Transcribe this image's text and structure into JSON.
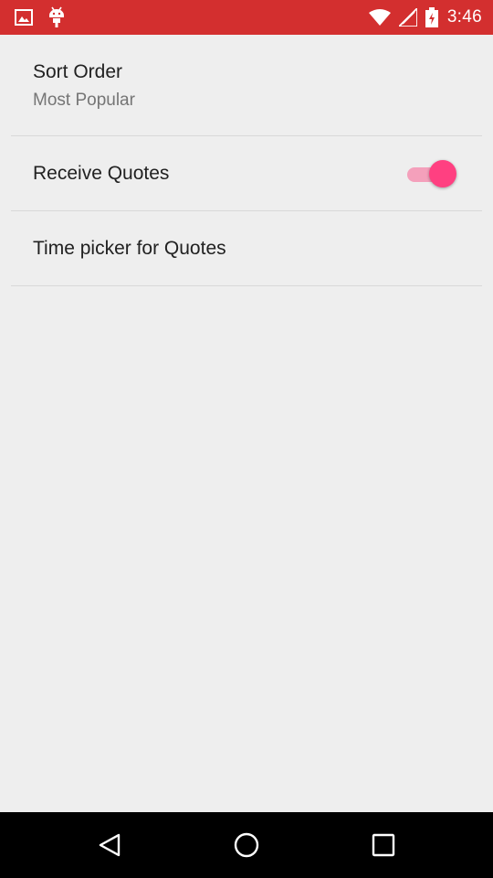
{
  "status_bar": {
    "time": "3:46",
    "color": "#d32f2f",
    "left_icons": [
      "image-icon",
      "android-icon"
    ],
    "right_icons": [
      "wifi-icon",
      "signal-icon",
      "battery-icon"
    ]
  },
  "preferences": {
    "sort_order": {
      "title": "Sort Order",
      "summary": "Most Popular"
    },
    "receive_quotes": {
      "title": "Receive Quotes",
      "enabled": true,
      "accent_color": "#ff4081"
    },
    "time_picker": {
      "title": "Time picker for Quotes"
    }
  },
  "nav_bar": {
    "buttons": [
      "back-icon",
      "home-icon",
      "recents-icon"
    ]
  }
}
